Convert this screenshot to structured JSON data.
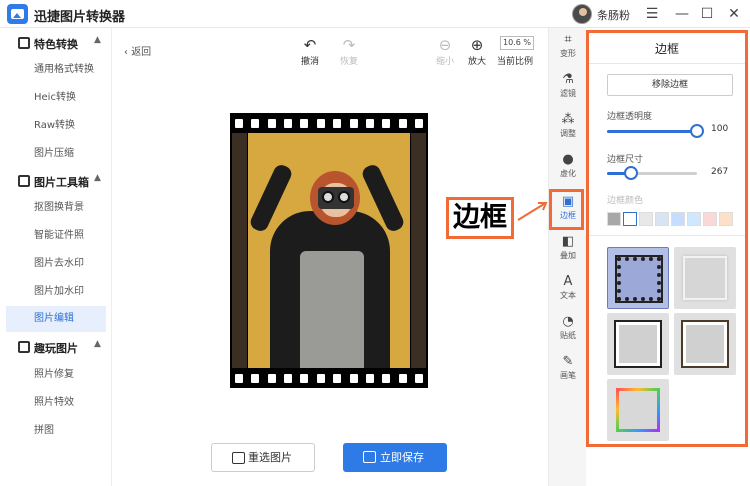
{
  "app": {
    "title": "迅捷图片转换器",
    "username": "条肠粉"
  },
  "window_controls": {
    "menu": "☰",
    "minimize": "—",
    "maximize": "☐",
    "close": "✕"
  },
  "sidebar": {
    "sections": [
      {
        "label": "特色转换",
        "items": [
          "通用格式转换",
          "Heic转换",
          "Raw转换",
          "图片压缩"
        ]
      },
      {
        "label": "图片工具箱",
        "items": [
          "抠图换背景",
          "智能证件照",
          "图片去水印",
          "图片加水印",
          "图片编辑"
        ]
      },
      {
        "label": "趣玩图片",
        "items": [
          "照片修复",
          "照片特效",
          "拼图"
        ]
      }
    ],
    "active_item": "图片编辑"
  },
  "toolbar": {
    "back": "返回",
    "undo": "撤消",
    "redo": "恢复",
    "zoom_out": "缩小",
    "zoom_in": "放大",
    "zoom_value": "10.6 %",
    "actual_ratio": "当前比例"
  },
  "bottom": {
    "reselect": "重选图片",
    "save": "立即保存"
  },
  "callout": {
    "text": "边框"
  },
  "rail": {
    "items": [
      "变形",
      "滤镜",
      "调整",
      "虚化",
      "边框",
      "叠加",
      "文本",
      "贴纸",
      "画笔"
    ],
    "active": "边框"
  },
  "panel": {
    "title": "边框",
    "remove_button": "移除边框",
    "opacity": {
      "label": "边框透明度",
      "value": "100",
      "fraction": 1.0
    },
    "size": {
      "label": "边框尺寸",
      "value": "267",
      "fraction": 0.27
    },
    "color_label": "边框颜色",
    "colors": [
      "#a8a8a8",
      "#ffffff",
      "#e8e8e8",
      "#d8e4f4",
      "#c6ddff",
      "#cfe8ff",
      "#fbd8d8",
      "#fde0c8"
    ],
    "selected_frame": 0
  },
  "colors": {
    "accent": "#2f6fd6",
    "highlight": "#f26b37",
    "save_button": "#2e7ae6"
  }
}
